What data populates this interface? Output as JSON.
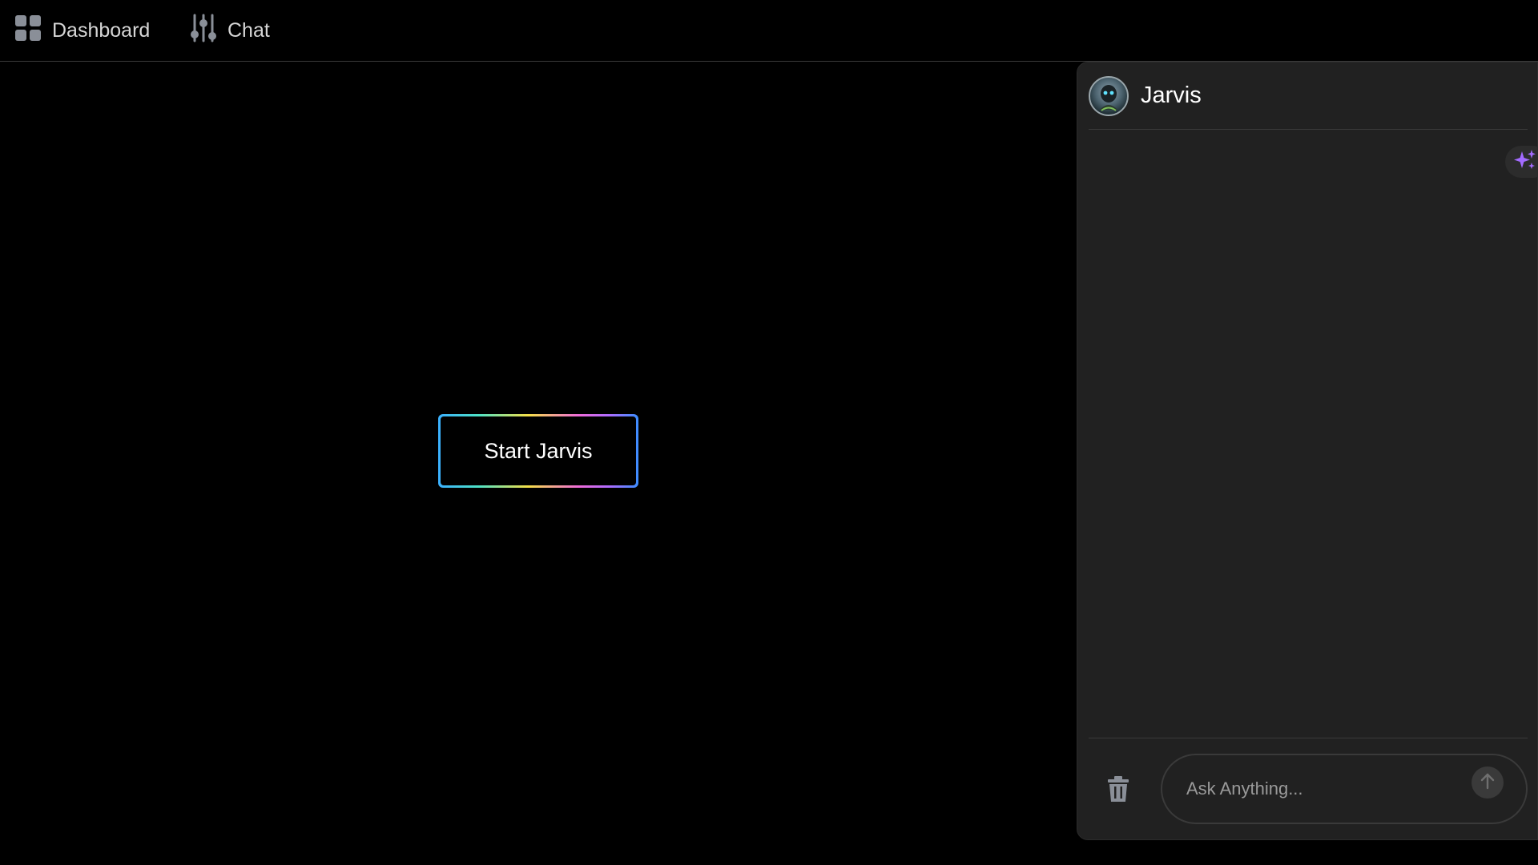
{
  "nav": {
    "items": [
      {
        "label": "Dashboard",
        "icon": "grid-icon"
      },
      {
        "label": "Chat",
        "icon": "sliders-icon"
      }
    ]
  },
  "main": {
    "start_button_label": "Start Jarvis"
  },
  "chat": {
    "title": "Jarvis",
    "input_placeholder": "Ask Anything...",
    "input_value": "",
    "accent_color": "#a36bff",
    "icons": {
      "avatar": "assistant-avatar",
      "sparkle": "sparkle-icon",
      "delete": "trash-icon",
      "send": "arrow-up-icon"
    }
  }
}
